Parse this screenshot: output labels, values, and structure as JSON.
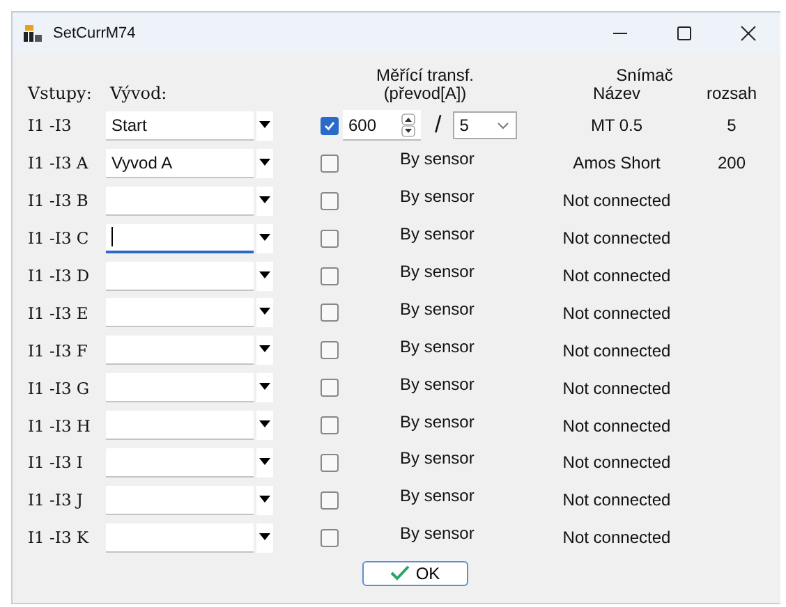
{
  "window": {
    "title": "SetCurrM74"
  },
  "headers": {
    "inputs": "Vstupy:",
    "output": "Vývod:",
    "transformer": "Měřící transf.",
    "transformer_ratio": "(převod[A])",
    "sensor": "Snímač",
    "sensor_name": "Název",
    "sensor_range": "rozsah"
  },
  "rows": [
    {
      "input": "I1 -I3",
      "output": "Start",
      "focused": false,
      "checked": true,
      "kind": "ratio",
      "primary": "600",
      "separator": "/",
      "secondary": "5",
      "sensor": "MT 0.5",
      "range": "5"
    },
    {
      "input": "I1 -I3 A",
      "output": "Vyvod A",
      "focused": false,
      "checked": false,
      "kind": "sensor",
      "transformer_text": "By sensor",
      "sensor": "Amos Short",
      "range": "200"
    },
    {
      "input": "I1 -I3 B",
      "focused": false,
      "checked": false,
      "kind": "sensor",
      "transformer_text": "By sensor",
      "sensor": "Not connected"
    },
    {
      "input": "I1 -I3 C",
      "focused": true,
      "checked": false,
      "kind": "sensor",
      "transformer_text": "By sensor",
      "sensor": "Not connected"
    },
    {
      "input": "I1 -I3 D",
      "focused": false,
      "checked": false,
      "kind": "sensor",
      "transformer_text": "By sensor",
      "sensor": "Not connected"
    },
    {
      "input": "I1 -I3 E",
      "focused": false,
      "checked": false,
      "kind": "sensor",
      "transformer_text": "By sensor",
      "sensor": "Not connected"
    },
    {
      "input": "I1 -I3 F",
      "focused": false,
      "checked": false,
      "kind": "sensor",
      "transformer_text": "By sensor",
      "sensor": "Not connected"
    },
    {
      "input": "I1 -I3 G",
      "focused": false,
      "checked": false,
      "kind": "sensor",
      "transformer_text": "By sensor",
      "sensor": "Not connected"
    },
    {
      "input": "I1 -I3 H",
      "focused": false,
      "checked": false,
      "kind": "sensor",
      "transformer_text": "By sensor",
      "sensor": "Not connected"
    },
    {
      "input": "I1 -I3 I",
      "focused": false,
      "checked": false,
      "kind": "sensor",
      "transformer_text": "By sensor",
      "sensor": "Not connected"
    },
    {
      "input": "I1 -I3 J",
      "focused": false,
      "checked": false,
      "kind": "sensor",
      "transformer_text": "By sensor",
      "sensor": "Not connected"
    },
    {
      "input": "I1 -I3 K",
      "focused": false,
      "checked": false,
      "kind": "sensor",
      "transformer_text": "By sensor",
      "sensor": "Not connected"
    }
  ],
  "ok_button": "OK"
}
